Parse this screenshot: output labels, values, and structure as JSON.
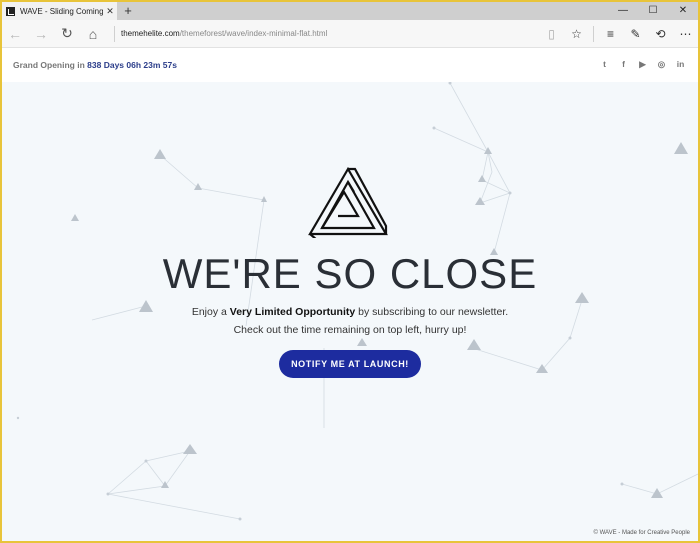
{
  "browser": {
    "tab_title": "WAVE - Sliding Coming",
    "tab_close": "✕",
    "new_tab": "+",
    "url_domain": "themehelite.com",
    "url_path": "/themeforest/wave/index-minimal-flat.html",
    "icons": [
      "back-icon",
      "forward-icon",
      "refresh-icon",
      "home-icon",
      "reading-view-icon",
      "favorite-star-icon",
      "hub-icon",
      "web-note-icon",
      "share-icon",
      "more-icon"
    ]
  },
  "page": {
    "countdown_label": "Grand Opening in",
    "countdown_value": "838 Days 06h 23m 57s",
    "social": [
      "twitter-icon",
      "facebook-icon",
      "youtube-icon",
      "dribbble-icon",
      "linkedin-icon"
    ],
    "headline": "WE'RE SO CLOSE",
    "text_prefix": "Enjoy a",
    "text_bold": "Very Limited Opportunity",
    "text_suffix": "by subscribing to our newsletter.",
    "text_line2": "Check out the time remaining on top left, hurry up!",
    "cta_label": "NOTIFY ME AT LAUNCH!",
    "footer": "© WAVE - Made for Creative People",
    "accent_color": "#1d2c9f"
  }
}
